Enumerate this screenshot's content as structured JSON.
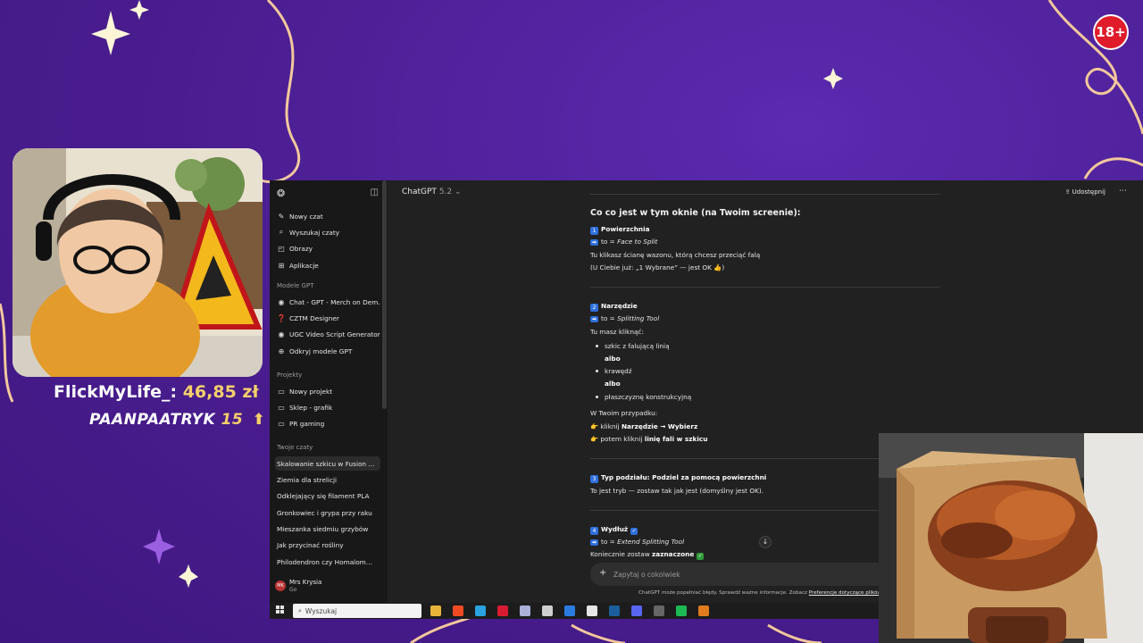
{
  "overlay": {
    "age_badge": "18+",
    "donation_1": {
      "name": "FlickMyLife_:",
      "amount": "46,85 zł"
    },
    "donation_2": {
      "name": "PAANPAATRYK",
      "amount": "15"
    }
  },
  "app": {
    "model_selector": {
      "name": "ChatGPT",
      "version": "5.2"
    },
    "share_label": "Udostępnij",
    "sidebar": {
      "items": [
        {
          "label": "Nowy czat",
          "icon": "new-chat-icon"
        },
        {
          "label": "Wyszukaj czaty",
          "icon": "search-icon"
        },
        {
          "label": "Obrazy",
          "icon": "image-icon"
        },
        {
          "label": "Aplikacje",
          "icon": "apps-icon"
        }
      ],
      "gpts_header": "Modele GPT",
      "gpts": [
        {
          "label": "Chat - GPT - Merch on Dem…"
        },
        {
          "label": "CZTM Designer"
        },
        {
          "label": "UGC Video Script Generator …"
        },
        {
          "label": "Odkryj modele GPT"
        }
      ],
      "projects_header": "Projekty",
      "projects": [
        {
          "label": "Nowy projekt"
        },
        {
          "label": "Sklep - grafik"
        },
        {
          "label": "PR gaming"
        }
      ],
      "chats_header": "Twoje czaty",
      "chats": [
        {
          "label": "Skalowanie szkicu w Fusion …"
        },
        {
          "label": "Ziemia dla strelicji"
        },
        {
          "label": "Odklejający się filament PLA"
        },
        {
          "label": "Gronkowiec i grypa przy raku"
        },
        {
          "label": "Mieszanka siedmiu grzybów"
        },
        {
          "label": "Jak przycinać rośliny"
        },
        {
          "label": "Philodendron czy Homalom…"
        }
      ],
      "user": {
        "name": "Mrs Krysia",
        "plan": "Go",
        "initials": "MK"
      }
    },
    "message": {
      "heading": "Co co jest w tym oknie (na Twoim screenie):",
      "s1_num": "1",
      "s1_title": "Powierzchnia",
      "s1_to": "to = ",
      "s1_to_val": "Face to Split",
      "s1_line1": "Tu klikasz ścianę wazonu, którą chcesz przeciąć falą",
      "s1_line2": "(U Ciebie już: „1 Wybrane” — jest OK 👍)",
      "s2_num": "2",
      "s2_title": "Narzędzie",
      "s2_to": "to = ",
      "s2_to_val": "Splitting Tool",
      "s2_intro": "Tu masz kliknąć:",
      "s2_b1": "szkic z falującą linią",
      "s2_or1": "albo",
      "s2_b2": "krawędź",
      "s2_or2": "albo",
      "s2_b3": "płaszczyznę konstrukcyjną",
      "s2_case": "W Twoim przypadku:",
      "s2_p1_pre": "kliknij ",
      "s2_p1_bold": "Narzędzie → Wybierz",
      "s2_p2_pre": "potem kliknij ",
      "s2_p2_bold": "linię fali w szkicu",
      "s3_num": "3",
      "s3_title": "Typ podziału: Podziel za pomocą powierzchni",
      "s3_line1": "To jest tryb — zostaw tak jak jest (domyślny jest OK).",
      "s4_num": "4",
      "s4_title": "Wydłuż",
      "s4_to": "to = ",
      "s4_to_val": "Extend Splitting Tool",
      "s4_line1_pre": "Koniecznie zostaw ",
      "s4_line1_bold": "zaznaczone"
    },
    "composer": {
      "placeholder": "Zapytaj o cokolwiek"
    },
    "footer": {
      "text": "ChatGPT może popełniać błędy. Sprawdź ważne informacje. Zobacz ",
      "link": "Preferencje dotyczące plików co"
    }
  },
  "taskbar": {
    "search_placeholder": "Wyszukaj",
    "apps": [
      {
        "name": "file-explorer-icon",
        "color": "#e8b53a"
      },
      {
        "name": "brave-icon",
        "color": "#f04a23"
      },
      {
        "name": "edge-icon",
        "color": "#2aa3e0"
      },
      {
        "name": "opera-icon",
        "color": "#d81b32"
      },
      {
        "name": "app-icon",
        "color": "#aab0d8"
      },
      {
        "name": "epic-icon",
        "color": "#cfcfcf"
      },
      {
        "name": "media-icon",
        "color": "#2b7be0"
      },
      {
        "name": "chrome-icon",
        "color": "#e6e6e6"
      },
      {
        "name": "steam-icon",
        "color": "#1b5f9e"
      },
      {
        "name": "discord-icon",
        "color": "#5865f2"
      },
      {
        "name": "app2-icon",
        "color": "#666"
      },
      {
        "name": "spotify-icon",
        "color": "#1db954"
      },
      {
        "name": "app3-icon",
        "color": "#e07b1e"
      }
    ]
  }
}
